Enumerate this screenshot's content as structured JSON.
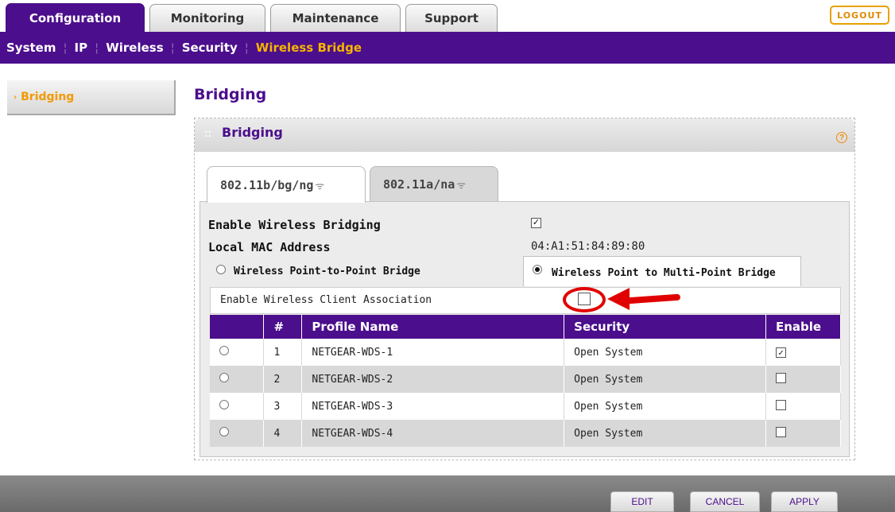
{
  "top_tabs": [
    {
      "label": "Configuration",
      "active": true
    },
    {
      "label": "Monitoring",
      "active": false
    },
    {
      "label": "Maintenance",
      "active": false
    },
    {
      "label": "Support",
      "active": false
    }
  ],
  "logout_label": "LOGOUT",
  "subnav": [
    "System",
    "IP",
    "Wireless",
    "Security",
    "Wireless Bridge"
  ],
  "subnav_active": "Wireless Bridge",
  "leftnav": {
    "item": "Bridging"
  },
  "page_title": "Bridging",
  "panel": {
    "title": "Bridging",
    "help": "?"
  },
  "band_tabs": [
    {
      "label": "802.11b/bg/ng",
      "active": true
    },
    {
      "label": "802.11a/na",
      "active": false
    }
  ],
  "settings": {
    "enable_bridging_label": "Enable Wireless Bridging",
    "enable_bridging_checked": true,
    "mac_label": "Local MAC Address",
    "mac_value": "04:A1:51:84:89:80",
    "p2p_label": "Wireless Point-to-Point Bridge",
    "p2p_selected": false,
    "p2mp_label": "Wireless Point to Multi-Point Bridge",
    "p2mp_selected": true,
    "client_assoc_label": "Enable Wireless Client Association",
    "client_assoc_checked": false
  },
  "table": {
    "headers": [
      "#",
      "Profile Name",
      "Security",
      "Enable"
    ],
    "rows": [
      {
        "num": "1",
        "name": "NETGEAR-WDS-1",
        "security": "Open System",
        "selected": true,
        "enabled": true
      },
      {
        "num": "2",
        "name": "NETGEAR-WDS-2",
        "security": "Open System",
        "selected": false,
        "enabled": false
      },
      {
        "num": "3",
        "name": "NETGEAR-WDS-3",
        "security": "Open System",
        "selected": false,
        "enabled": false
      },
      {
        "num": "4",
        "name": "NETGEAR-WDS-4",
        "security": "Open System",
        "selected": false,
        "enabled": false
      }
    ]
  },
  "buttons": {
    "edit": "EDIT",
    "cancel": "CANCEL",
    "apply": "APPLY"
  },
  "colors": {
    "brand_purple": "#4b0e8c",
    "accent_orange": "#f29a00",
    "highlight_red": "#e00000"
  }
}
